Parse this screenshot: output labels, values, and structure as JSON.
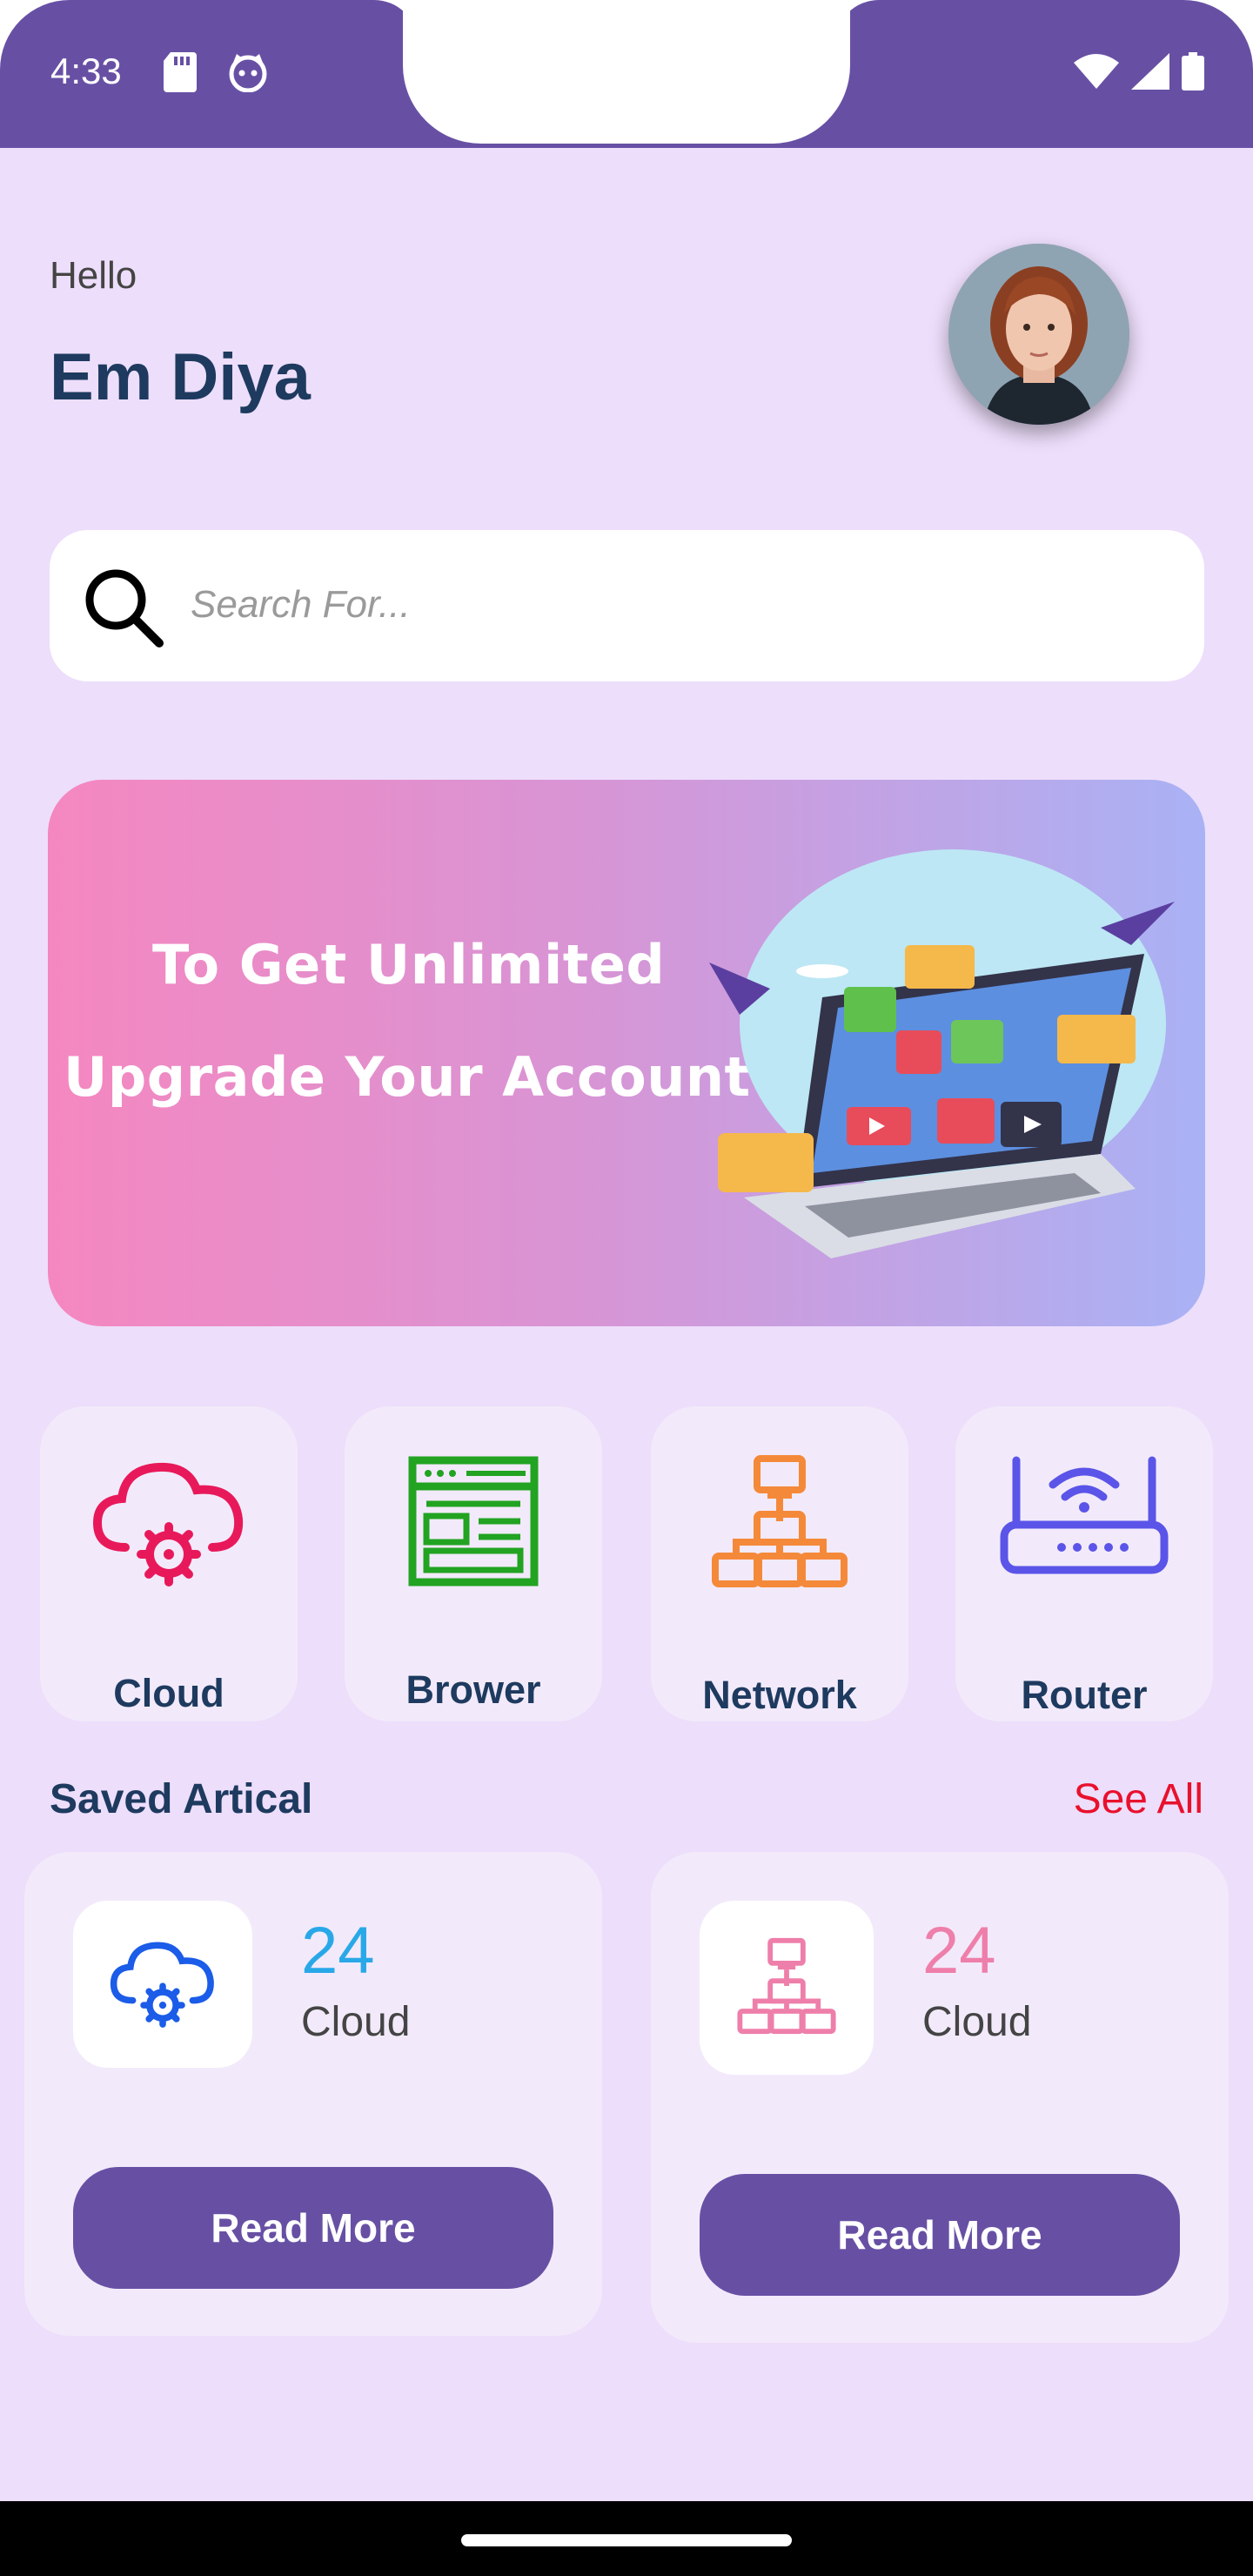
{
  "status_bar": {
    "time": "4:33",
    "left_icons": [
      "sd-card-icon",
      "cat-face-icon"
    ],
    "right_icons": [
      "wifi-icon",
      "signal-icon",
      "battery-icon"
    ],
    "bar_color": "#6750A4"
  },
  "header": {
    "greeting": "Hello",
    "name": "Em Diya"
  },
  "search": {
    "placeholder": "Search For..."
  },
  "banner": {
    "line1": "To Get Unlimited",
    "line2": "Upgrade Your Account",
    "gradient_start": "#F587C0",
    "gradient_end": "#A9B2F5"
  },
  "categories": [
    {
      "label": "Cloud",
      "icon": "cloud-gear-icon",
      "color": "#E8195A"
    },
    {
      "label": "Brower",
      "icon": "browser-window-icon",
      "color": "#22A322"
    },
    {
      "label": "Network",
      "icon": "network-icon",
      "color": "#F5893A"
    },
    {
      "label": "Router",
      "icon": "router-icon",
      "color": "#5B54E8"
    }
  ],
  "saved": {
    "title": "Saved Artical",
    "see_all": "See All",
    "cards": [
      {
        "count": "24",
        "name": "Cloud",
        "icon": "cloud-gear-icon",
        "count_color": "#29A8E8",
        "button": "Read More"
      },
      {
        "count": "24",
        "name": "Cloud",
        "icon": "network-icon",
        "count_color": "#EE7FAA",
        "button": "Read More"
      }
    ]
  },
  "colors": {
    "background": "#EDDEFB",
    "primary": "#6750A4",
    "heading": "#1E3A5F",
    "link": "#E8112D"
  }
}
